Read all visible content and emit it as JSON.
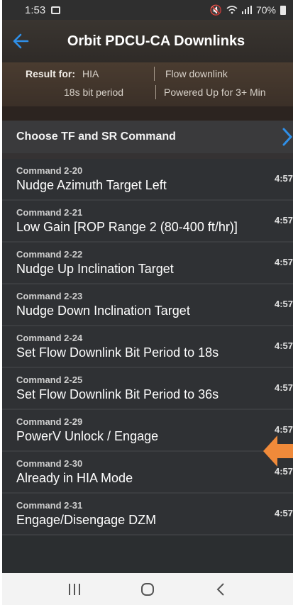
{
  "status_bar": {
    "time": "1:53",
    "battery": "70%"
  },
  "header": {
    "title": "Orbit PDCU-CA Downlinks"
  },
  "result": {
    "label": "Result for:",
    "mode": "HIA",
    "bit_period": "18s bit period",
    "downlink": "Flow downlink",
    "power": "Powered Up for 3+ Min"
  },
  "choose": {
    "label": "Choose TF and SR Command"
  },
  "commands": [
    {
      "id": "Command 2-20",
      "name": "Nudge Azimuth Target Left",
      "time": "4:57"
    },
    {
      "id": "Command 2-21",
      "name": "Low Gain  [ROP Range 2 (80-400 ft/hr)]",
      "time": "4:57"
    },
    {
      "id": "Command 2-22",
      "name": "Nudge Up Inclination Target",
      "time": "4:57"
    },
    {
      "id": "Command 2-23",
      "name": "Nudge Down Inclination Target",
      "time": "4:57"
    },
    {
      "id": "Command 2-24",
      "name": "Set Flow Downlink Bit Period to 18s",
      "time": "4:57"
    },
    {
      "id": "Command 2-25",
      "name": "Set Flow Downlink Bit Period to 36s",
      "time": "4:57"
    },
    {
      "id": "Command 2-29",
      "name": "PowerV Unlock / Engage",
      "time": "4:57"
    },
    {
      "id": "Command 2-30",
      "name": "Already in HIA Mode",
      "time": "4:57"
    },
    {
      "id": "Command 2-31",
      "name": "Engage/Disengage DZM",
      "time": "4:57"
    }
  ],
  "colors": {
    "accent": "#2f8fe8",
    "annotation_arrow": "#f08a3a"
  }
}
